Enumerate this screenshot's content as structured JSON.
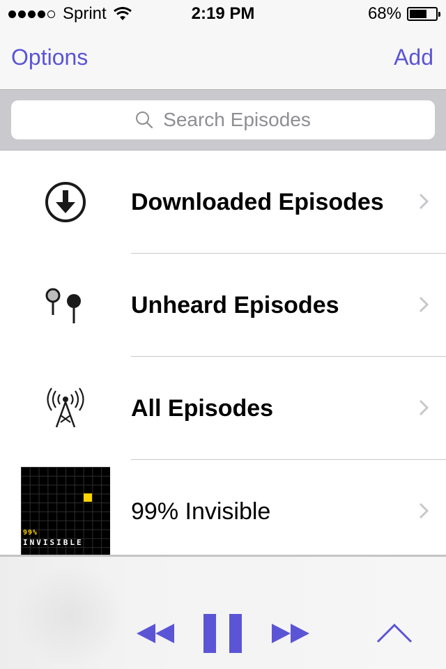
{
  "status_bar": {
    "carrier": "Sprint",
    "time": "2:19 PM",
    "battery_percent": "68%",
    "battery_level": 0.68,
    "signal_bars": 4,
    "signal_max": 5
  },
  "nav": {
    "left_label": "Options",
    "right_label": "Add"
  },
  "search": {
    "placeholder": "Search Episodes"
  },
  "list": {
    "items": [
      {
        "label": "Downloaded Episodes",
        "icon": "download-icon"
      },
      {
        "label": "Unheard Episodes",
        "icon": "earbuds-icon"
      },
      {
        "label": "All Episodes",
        "icon": "broadcast-tower-icon"
      },
      {
        "label": "99% Invisible",
        "icon": "podcast-artwork",
        "artwork_text_top": "99%",
        "artwork_text_bottom": "INVISIBLE"
      }
    ]
  },
  "player": {
    "controls": [
      "rewind-icon",
      "pause-icon",
      "fast-forward-icon",
      "chevron-up-icon"
    ]
  },
  "colors": {
    "accent": "#5b55d6",
    "artwork_accent": "#ffd400"
  }
}
